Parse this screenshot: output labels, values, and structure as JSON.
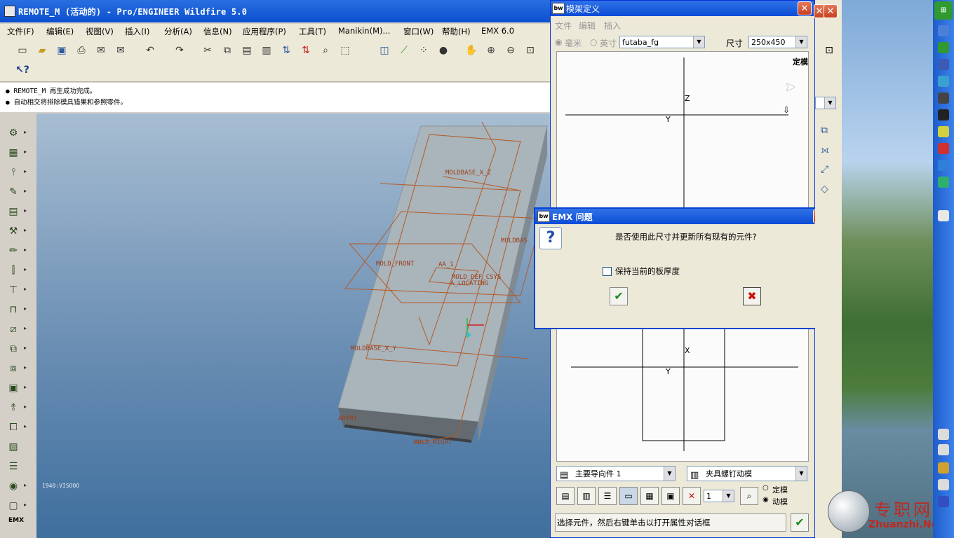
{
  "proe": {
    "title": "REMOTE_M (活动的) - Pro/ENGINEER Wildfire 5.0",
    "menus": [
      "文件(F)",
      "编辑(E)",
      "视图(V)",
      "插入(I)",
      "分析(A)",
      "信息(N)",
      "应用程序(P)",
      "工具(T)",
      "Manikin(M)...",
      "窗口(W)",
      "帮助(H)",
      "EMX 6.0"
    ],
    "messages": [
      "● REMOTE_M 再生成功完成。",
      "● 自动相交将排除模具错果和参照零件。"
    ],
    "datums": [
      "MOLDBASE_X_Z",
      "MOLDBAS",
      "MOLD_FRONT",
      "AA_1",
      "MOLD_DEF_CSYS",
      "A_LOCATING",
      "MOLDBASE_X_Y",
      "ADTM1",
      "MOLD_RIGHT"
    ],
    "status_corner": "1940:VISOOO",
    "emx_label": "EMX"
  },
  "mold": {
    "title": "模架定义",
    "menus": [
      "文件",
      "编辑",
      "插入"
    ],
    "unit_mm": "毫米",
    "unit_inch": "英寸",
    "vendor": "futaba_fg",
    "size_label": "尺寸",
    "size_value": "250x450",
    "side_label": "定模",
    "axis_z": "Z",
    "axis_y_top": "Y",
    "axis_x": "X",
    "axis_y_bottom": "Y",
    "guide_dropdown": "主要导向件 1",
    "screw_dropdown": "夹具螺钉动模",
    "qty_value": "1",
    "opt_fixed": "定模",
    "opt_moving": "动模",
    "status": "选择元件，然后右键单击以打开属性对话框"
  },
  "dialog": {
    "title": "EMX 问题",
    "question": "是否使用此尺寸并更新所有现有的元件?",
    "checkbox_label": "保持当前的板厚度"
  },
  "watermark": {
    "cn": "专职网",
    "en": "Zhuanzhi.Net"
  },
  "colors": {
    "xp_blue": "#0c4cd6",
    "datum_orange": "#9b3d14",
    "ok_green": "#1a8a1a",
    "cancel_red": "#d01010"
  }
}
